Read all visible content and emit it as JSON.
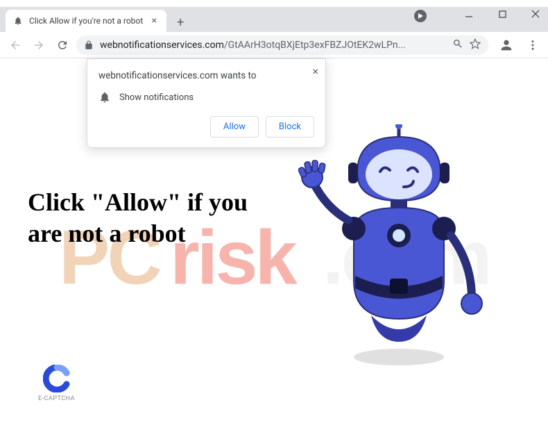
{
  "window": {
    "tab_title": "Click Allow if you're not a robot"
  },
  "toolbar": {
    "url_domain": "webnotificationservices.com",
    "url_path": "/GtAArH3otqBXjEtp3exFBZJOtEK2wLPn..."
  },
  "permission": {
    "origin_text": "webnotificationservices.com wants to",
    "permission_text": "Show notifications",
    "allow_label": "Allow",
    "block_label": "Block"
  },
  "page": {
    "headline": "Click \"Allow\" if you are not a robot",
    "ecaptcha_label": "E-CAPTCHA"
  },
  "watermark": {
    "text_pc": "PC",
    "text_risk": "risk",
    "text_com": ".com"
  }
}
